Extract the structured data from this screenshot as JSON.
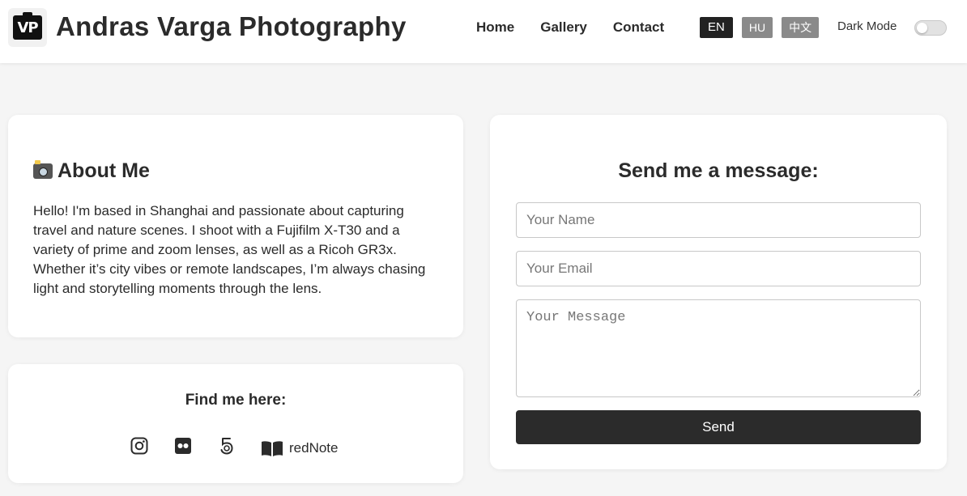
{
  "header": {
    "logo_text": "VP",
    "title": "Andras Varga Photography",
    "nav": [
      {
        "label": "Home"
      },
      {
        "label": "Gallery"
      },
      {
        "label": "Contact"
      }
    ],
    "languages": [
      {
        "label": "EN",
        "active": true
      },
      {
        "label": "HU",
        "active": false
      },
      {
        "label": "中文",
        "active": false
      }
    ],
    "dark_mode_label": "Dark Mode",
    "dark_mode_on": false
  },
  "about": {
    "icon": "camera-flash-icon",
    "heading": "About Me",
    "body": "Hello! I'm based in Shanghai and passionate about capturing travel and nature scenes. I shoot with a Fujifilm X-T30 and a variety of prime and zoom lenses, as well as a Ricoh GR3x. Whether it’s city vibes or remote landscapes, I’m always chasing light and storytelling moments through the lens."
  },
  "find_me": {
    "heading": "Find me here:",
    "links": [
      {
        "icon": "instagram-icon"
      },
      {
        "icon": "flickr-icon"
      },
      {
        "icon": "500px-icon"
      },
      {
        "icon": "book-icon",
        "label": "redNote"
      }
    ]
  },
  "contact": {
    "heading": "Send me a message:",
    "name_placeholder": "Your Name",
    "email_placeholder": "Your Email",
    "message_placeholder": "Your Message",
    "send_label": "Send"
  },
  "colors": {
    "background": "#f5f5f5",
    "card": "#ffffff",
    "text": "#2b2b2b",
    "button": "#2b2b2b",
    "lang_active": "#222222",
    "lang_inactive": "#8a8a8a"
  }
}
